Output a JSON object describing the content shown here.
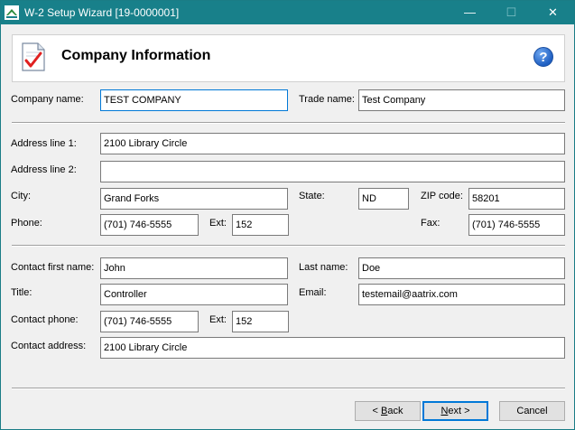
{
  "window": {
    "title": "W-2 Setup Wizard [19-0000001]",
    "minimize": "—",
    "maximize": "☐",
    "close": "✕"
  },
  "header": {
    "title": "Company Information",
    "help": "?"
  },
  "company": {
    "company_name_label": "Company name:",
    "company_name": "TEST COMPANY",
    "trade_name_label": "Trade name:",
    "trade_name": "Test Company"
  },
  "address": {
    "line1_label": "Address line 1:",
    "line1": "2100 Library Circle",
    "line2_label": "Address line 2:",
    "line2": "",
    "city_label": "City:",
    "city": "Grand Forks",
    "state_label": "State:",
    "state": "ND",
    "zip_label": "ZIP code:",
    "zip": "58201",
    "phone_label": "Phone:",
    "phone": "(701) 746-5555",
    "ext_label": "Ext:",
    "ext": "152",
    "fax_label": "Fax:",
    "fax": "(701) 746-5555"
  },
  "contact": {
    "first_name_label": "Contact first name:",
    "first_name": "John",
    "last_name_label": "Last name:",
    "last_name": "Doe",
    "title_label": "Title:",
    "title": "Controller",
    "email_label": "Email:",
    "email": "testemail@aatrix.com",
    "phone_label": "Contact phone:",
    "phone": "(701) 746-5555",
    "ext_label": "Ext:",
    "ext": "152",
    "address_label": "Contact address:",
    "address": "2100 Library Circle"
  },
  "buttons": {
    "back_prefix": "< ",
    "back_key": "B",
    "back_rest": "ack",
    "next_key": "N",
    "next_rest": "ext >",
    "cancel": "Cancel"
  },
  "colors": {
    "titlebar": "#18808a",
    "focus": "#0078d7",
    "help": "#1f5fc2",
    "check": "#e02020"
  }
}
